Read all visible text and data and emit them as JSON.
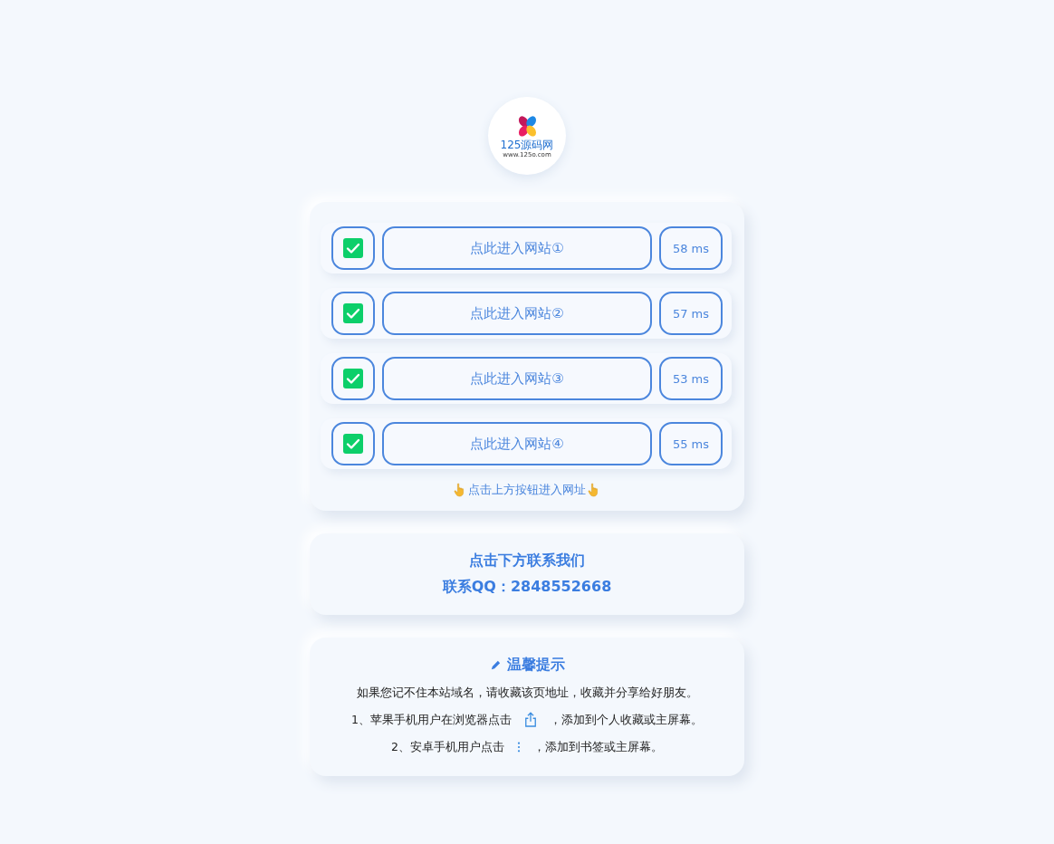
{
  "logo": {
    "name": "125源码网",
    "url": "www.125o.com"
  },
  "sites": [
    {
      "checked": true,
      "label": "点此进入网站①",
      "latency": "58 ms"
    },
    {
      "checked": true,
      "label": "点此进入网站②",
      "latency": "57 ms"
    },
    {
      "checked": true,
      "label": "点此进入网站③",
      "latency": "53 ms"
    },
    {
      "checked": true,
      "label": "点此进入网站④",
      "latency": "55 ms"
    }
  ],
  "hint": "点击上方按钮进入网址",
  "contact": {
    "title": "点击下方联系我们",
    "qq": "联系QQ：2848552668"
  },
  "tips": {
    "title": "温馨提示",
    "lines": [
      {
        "kind": "plain",
        "text": "如果您记不住本站域名，请收藏该页地址，收藏并分享给好朋友。"
      },
      {
        "kind": "share",
        "before": "1、苹果手机用户在浏览器点击",
        "after": "，添加到个人收藏或主屏幕。"
      },
      {
        "kind": "more",
        "before": "2、安卓手机用户点击",
        "after": "，添加到书签或主屏幕。"
      }
    ]
  }
}
